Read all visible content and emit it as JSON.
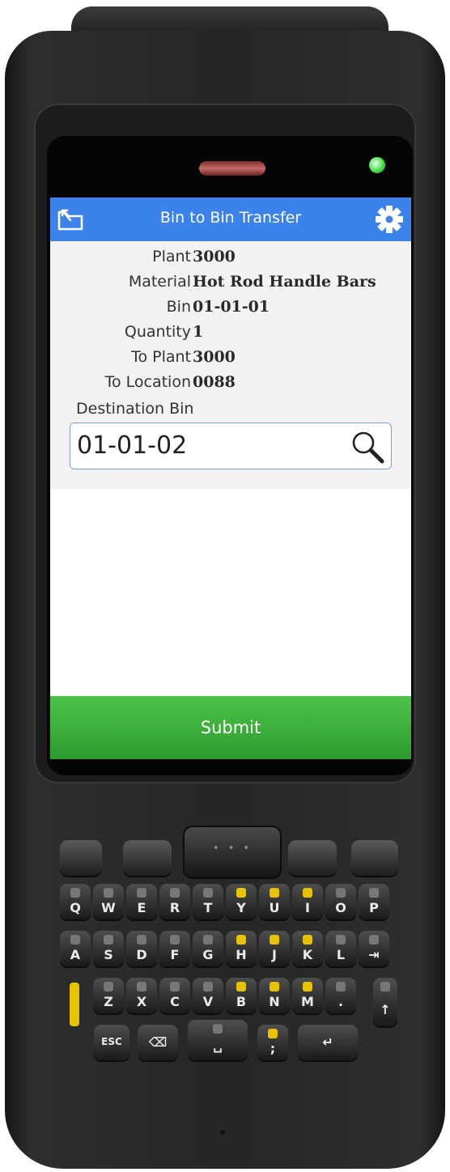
{
  "app": {
    "title": "Bin to Bin Transfer"
  },
  "fields": [
    {
      "label": "Plant",
      "value": "3000"
    },
    {
      "label": "Material",
      "value": "Hot Rod Handle Bars"
    },
    {
      "label": "Bin",
      "value": "01-01-01"
    },
    {
      "label": "Quantity",
      "value": "1"
    },
    {
      "label": "To Plant",
      "value": "3000"
    },
    {
      "label": "To Location",
      "value": "0088"
    }
  ],
  "destination": {
    "label": "Destination Bin",
    "value": "01-01-02"
  },
  "actions": {
    "submit_label": "Submit"
  },
  "colors": {
    "header": "#3b82ea",
    "submit": "#3aae37",
    "form_background": "#f2f2f2"
  },
  "icons": {
    "back": "back-icon",
    "settings": "gear-icon",
    "search": "search-icon"
  },
  "keypad": {
    "row1": [
      "Q",
      "W",
      "E",
      "R",
      "T",
      "Y",
      "U",
      "I",
      "O",
      "P"
    ],
    "row2": [
      "A",
      "S",
      "D",
      "F",
      "G",
      "H",
      "J",
      "K",
      "L",
      "⇥"
    ],
    "row3": [
      "Z",
      "X",
      "C",
      "V",
      "B",
      "N",
      "M",
      ".",
      "↑"
    ],
    "row4": [
      "ESC",
      "⌫",
      "␣",
      ";",
      "↵"
    ]
  }
}
